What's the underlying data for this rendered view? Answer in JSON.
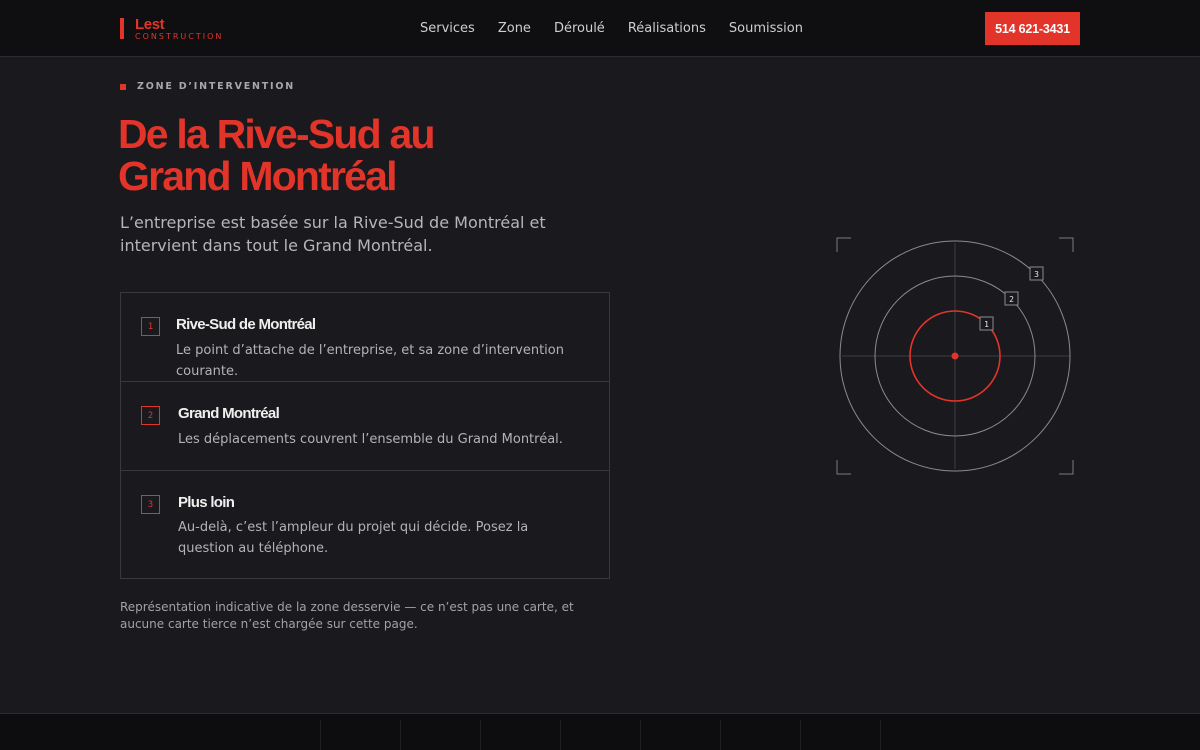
{
  "header": {
    "brand_name": "Lest",
    "brand_sub": "CONSTRUCTION",
    "nav": [
      "Services",
      "Zone",
      "Déroulé",
      "Réalisations",
      "Soumission"
    ],
    "phone": "514 621-3431"
  },
  "section": {
    "eyebrow": "ZONE D’INTERVENTION",
    "headline_line1": "De la Rive-Sud au",
    "headline_line2": "Grand Montréal",
    "lead": "L’entreprise est basée sur la Rive-Sud de Montréal et intervient dans tout le Grand Montréal."
  },
  "zones": [
    {
      "num": "1",
      "title": "Rive-Sud de Montréal",
      "desc": "Le point d’attache de l’entreprise, et sa zone d’intervention courante."
    },
    {
      "num": "2",
      "title": "Grand Montréal",
      "desc": "Les déplacements couvrent l’ensemble du Grand Montréal."
    },
    {
      "num": "3",
      "title": "Plus loin",
      "desc": "Au-delà, c’est l’ampleur du projet qui décide. Posez la question au téléphone."
    }
  ],
  "footnote": "Représentation indicative de la zone desservie — ce n’est pas une carte, et aucune carte tierce n’est chargée sur cette page.",
  "radar": {
    "labels": [
      "1",
      "2",
      "3"
    ],
    "accent": "#e3342a",
    "ring_color": "#8c8a8e"
  },
  "colors": {
    "accent": "#e3342a",
    "background": "#1a191d",
    "header_bg": "#0f0f11"
  },
  "icons": {
    "brand_mark": "red-bar-icon",
    "eyebrow_marker": "red-square-icon",
    "radar_center": "red-dot-icon"
  }
}
